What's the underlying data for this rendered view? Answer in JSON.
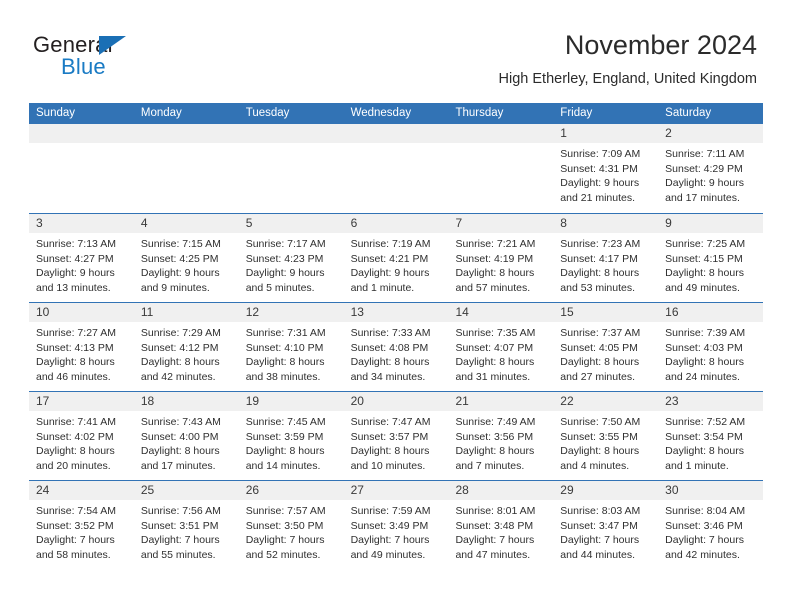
{
  "brand": {
    "name_top": "General",
    "name_bottom": "Blue",
    "triangle_color": "#1a6fb5",
    "blue_color": "#1a7bc4"
  },
  "header": {
    "title": "November 2024",
    "subtitle": "High Etherley, England, United Kingdom",
    "accent_color": "#3273b5"
  },
  "calendar": {
    "weekdays": [
      "Sunday",
      "Monday",
      "Tuesday",
      "Wednesday",
      "Thursday",
      "Friday",
      "Saturday"
    ],
    "weeks": [
      [
        {
          "day": "",
          "lines": []
        },
        {
          "day": "",
          "lines": []
        },
        {
          "day": "",
          "lines": []
        },
        {
          "day": "",
          "lines": []
        },
        {
          "day": "",
          "lines": []
        },
        {
          "day": "1",
          "lines": [
            "Sunrise: 7:09 AM",
            "Sunset: 4:31 PM",
            "Daylight: 9 hours",
            "and 21 minutes."
          ]
        },
        {
          "day": "2",
          "lines": [
            "Sunrise: 7:11 AM",
            "Sunset: 4:29 PM",
            "Daylight: 9 hours",
            "and 17 minutes."
          ]
        }
      ],
      [
        {
          "day": "3",
          "lines": [
            "Sunrise: 7:13 AM",
            "Sunset: 4:27 PM",
            "Daylight: 9 hours",
            "and 13 minutes."
          ]
        },
        {
          "day": "4",
          "lines": [
            "Sunrise: 7:15 AM",
            "Sunset: 4:25 PM",
            "Daylight: 9 hours",
            "and 9 minutes."
          ]
        },
        {
          "day": "5",
          "lines": [
            "Sunrise: 7:17 AM",
            "Sunset: 4:23 PM",
            "Daylight: 9 hours",
            "and 5 minutes."
          ]
        },
        {
          "day": "6",
          "lines": [
            "Sunrise: 7:19 AM",
            "Sunset: 4:21 PM",
            "Daylight: 9 hours",
            "and 1 minute."
          ]
        },
        {
          "day": "7",
          "lines": [
            "Sunrise: 7:21 AM",
            "Sunset: 4:19 PM",
            "Daylight: 8 hours",
            "and 57 minutes."
          ]
        },
        {
          "day": "8",
          "lines": [
            "Sunrise: 7:23 AM",
            "Sunset: 4:17 PM",
            "Daylight: 8 hours",
            "and 53 minutes."
          ]
        },
        {
          "day": "9",
          "lines": [
            "Sunrise: 7:25 AM",
            "Sunset: 4:15 PM",
            "Daylight: 8 hours",
            "and 49 minutes."
          ]
        }
      ],
      [
        {
          "day": "10",
          "lines": [
            "Sunrise: 7:27 AM",
            "Sunset: 4:13 PM",
            "Daylight: 8 hours",
            "and 46 minutes."
          ]
        },
        {
          "day": "11",
          "lines": [
            "Sunrise: 7:29 AM",
            "Sunset: 4:12 PM",
            "Daylight: 8 hours",
            "and 42 minutes."
          ]
        },
        {
          "day": "12",
          "lines": [
            "Sunrise: 7:31 AM",
            "Sunset: 4:10 PM",
            "Daylight: 8 hours",
            "and 38 minutes."
          ]
        },
        {
          "day": "13",
          "lines": [
            "Sunrise: 7:33 AM",
            "Sunset: 4:08 PM",
            "Daylight: 8 hours",
            "and 34 minutes."
          ]
        },
        {
          "day": "14",
          "lines": [
            "Sunrise: 7:35 AM",
            "Sunset: 4:07 PM",
            "Daylight: 8 hours",
            "and 31 minutes."
          ]
        },
        {
          "day": "15",
          "lines": [
            "Sunrise: 7:37 AM",
            "Sunset: 4:05 PM",
            "Daylight: 8 hours",
            "and 27 minutes."
          ]
        },
        {
          "day": "16",
          "lines": [
            "Sunrise: 7:39 AM",
            "Sunset: 4:03 PM",
            "Daylight: 8 hours",
            "and 24 minutes."
          ]
        }
      ],
      [
        {
          "day": "17",
          "lines": [
            "Sunrise: 7:41 AM",
            "Sunset: 4:02 PM",
            "Daylight: 8 hours",
            "and 20 minutes."
          ]
        },
        {
          "day": "18",
          "lines": [
            "Sunrise: 7:43 AM",
            "Sunset: 4:00 PM",
            "Daylight: 8 hours",
            "and 17 minutes."
          ]
        },
        {
          "day": "19",
          "lines": [
            "Sunrise: 7:45 AM",
            "Sunset: 3:59 PM",
            "Daylight: 8 hours",
            "and 14 minutes."
          ]
        },
        {
          "day": "20",
          "lines": [
            "Sunrise: 7:47 AM",
            "Sunset: 3:57 PM",
            "Daylight: 8 hours",
            "and 10 minutes."
          ]
        },
        {
          "day": "21",
          "lines": [
            "Sunrise: 7:49 AM",
            "Sunset: 3:56 PM",
            "Daylight: 8 hours",
            "and 7 minutes."
          ]
        },
        {
          "day": "22",
          "lines": [
            "Sunrise: 7:50 AM",
            "Sunset: 3:55 PM",
            "Daylight: 8 hours",
            "and 4 minutes."
          ]
        },
        {
          "day": "23",
          "lines": [
            "Sunrise: 7:52 AM",
            "Sunset: 3:54 PM",
            "Daylight: 8 hours",
            "and 1 minute."
          ]
        }
      ],
      [
        {
          "day": "24",
          "lines": [
            "Sunrise: 7:54 AM",
            "Sunset: 3:52 PM",
            "Daylight: 7 hours",
            "and 58 minutes."
          ]
        },
        {
          "day": "25",
          "lines": [
            "Sunrise: 7:56 AM",
            "Sunset: 3:51 PM",
            "Daylight: 7 hours",
            "and 55 minutes."
          ]
        },
        {
          "day": "26",
          "lines": [
            "Sunrise: 7:57 AM",
            "Sunset: 3:50 PM",
            "Daylight: 7 hours",
            "and 52 minutes."
          ]
        },
        {
          "day": "27",
          "lines": [
            "Sunrise: 7:59 AM",
            "Sunset: 3:49 PM",
            "Daylight: 7 hours",
            "and 49 minutes."
          ]
        },
        {
          "day": "28",
          "lines": [
            "Sunrise: 8:01 AM",
            "Sunset: 3:48 PM",
            "Daylight: 7 hours",
            "and 47 minutes."
          ]
        },
        {
          "day": "29",
          "lines": [
            "Sunrise: 8:03 AM",
            "Sunset: 3:47 PM",
            "Daylight: 7 hours",
            "and 44 minutes."
          ]
        },
        {
          "day": "30",
          "lines": [
            "Sunrise: 8:04 AM",
            "Sunset: 3:46 PM",
            "Daylight: 7 hours",
            "and 42 minutes."
          ]
        }
      ]
    ]
  }
}
